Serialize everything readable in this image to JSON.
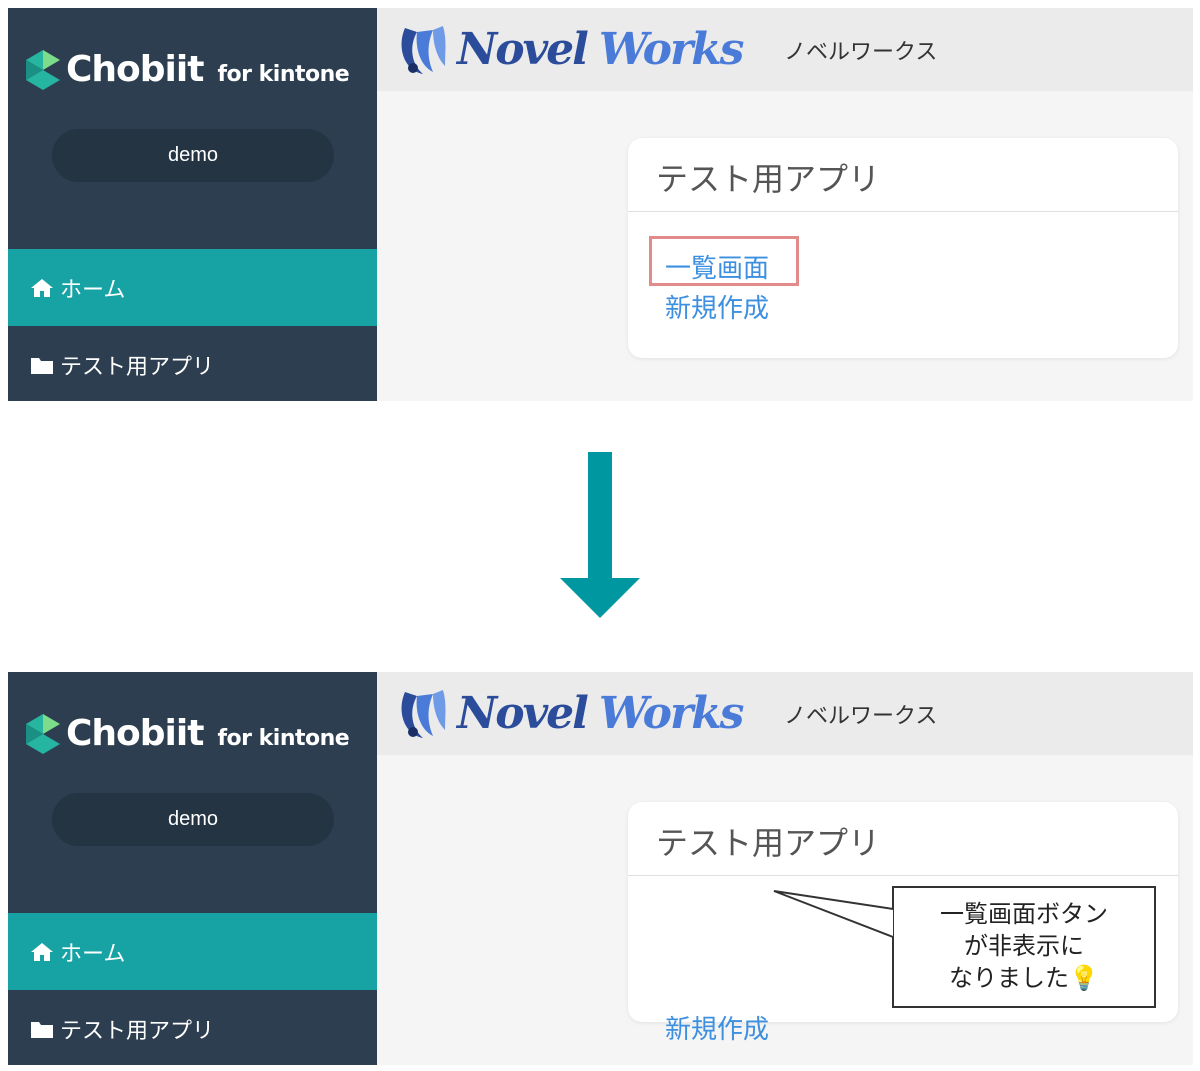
{
  "screens": {
    "before": {
      "brand": {
        "name": "Chobiit",
        "suffix": "for kintone"
      },
      "user": "demo",
      "nav": {
        "home": "ホーム",
        "app": "テスト用アプリ"
      },
      "header": {
        "logo_word1": "Novel",
        "logo_word2": "Works",
        "logo_kana": "ノベルワークス"
      },
      "card": {
        "title": "テスト用アプリ",
        "link_list": "一覧画面",
        "link_new": "新規作成"
      }
    },
    "after": {
      "brand": {
        "name": "Chobiit",
        "suffix": "for kintone"
      },
      "user": "demo",
      "nav": {
        "home": "ホーム",
        "app": "テスト用アプリ"
      },
      "header": {
        "logo_word1": "Novel",
        "logo_word2": "Works",
        "logo_kana": "ノベルワークス"
      },
      "card": {
        "title": "テスト用アプリ",
        "link_new": "新規作成"
      }
    }
  },
  "callout": {
    "lines": [
      "一覧画面ボタン",
      "が非表示に",
      "なりました💡"
    ]
  },
  "colors": {
    "sidebar": "#2c3e50",
    "nav_active": "#17a2a4",
    "link": "#3d8fe0",
    "highlight": "#e38b8b",
    "arrow": "#0097a0",
    "brand_accent": "#26b5a0"
  },
  "icons": {
    "brand": "chobiit-logo-icon",
    "home": "home-icon",
    "folder": "folder-icon",
    "arrow": "arrow-down-icon",
    "logo": "novelworks-logo-icon"
  }
}
